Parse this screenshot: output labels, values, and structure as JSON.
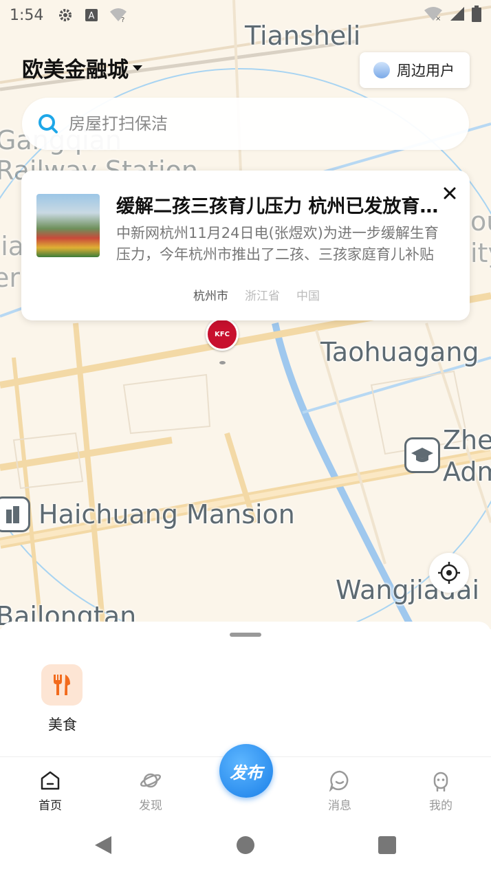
{
  "status_bar": {
    "time": "1:54",
    "icons": [
      "settings-icon",
      "a-icon",
      "wifi-question-icon"
    ],
    "right_icons": [
      "wifi-off-icon",
      "signal-icon",
      "battery-icon"
    ]
  },
  "map": {
    "labels": {
      "tiansheli": "Tiansheli",
      "gangqian": "Gangqian",
      "railway": "Railway Station",
      "taohuagang": "Taohuagang",
      "zhe": "Zhej",
      "adm": "Adm",
      "haichuang": "Haichuang Mansion",
      "wangjiadai": "Wangjiadai",
      "bailongtan": "Bailongtan",
      "left1": "Jia",
      "left2": "er",
      "right1": "ou",
      "right2": "ity"
    },
    "marker_brand": "KFC"
  },
  "header": {
    "city": "欧美金融城",
    "nearby_users": "周边用户"
  },
  "search": {
    "placeholder": "房屋打扫保洁"
  },
  "news_card": {
    "title": "缓解二孩三孩育儿压力 杭州已发放育儿补贴",
    "body": "中新网杭州11月24日电(张煜欢)为进一步缓解生育压力，今年杭州市推出了二孩、三孩家庭育儿补贴政策",
    "tags": [
      "杭州市",
      "浙江省",
      "中国"
    ]
  },
  "categories": [
    {
      "label": "美食",
      "icon": "fork-knife-icon",
      "color": "#f26b1d"
    }
  ],
  "tabs": {
    "home": "首页",
    "discover": "发现",
    "publish": "发布",
    "messages": "消息",
    "profile": "我的"
  },
  "colors": {
    "accent": "#1a7fe8",
    "map_bg": "#fbf5ea",
    "road": "#f3d9a6",
    "water": "#9fc8ee",
    "kfc_red": "#c8102e"
  }
}
